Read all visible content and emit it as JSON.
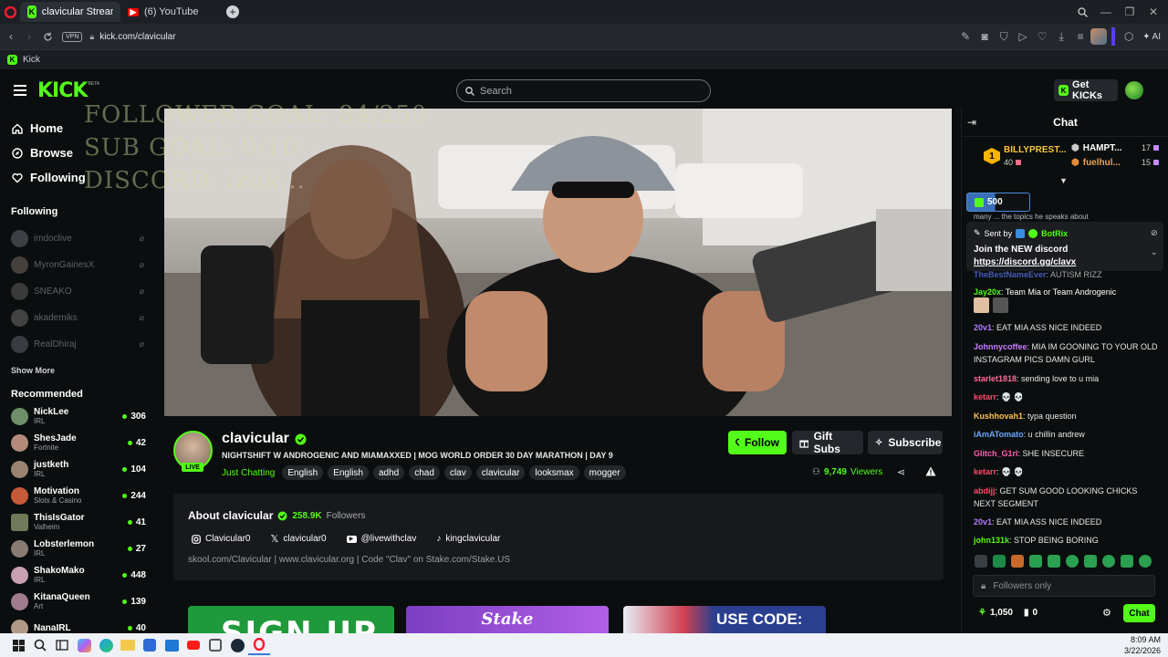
{
  "browser": {
    "tabs": [
      {
        "label": "clavicular Stream - W...",
        "active": true
      },
      {
        "label": "(6) YouTube",
        "active": false
      }
    ],
    "url": "kick.com/clavicular",
    "vpn": "VPN",
    "bookmark": "Kick",
    "ai_label": "AI"
  },
  "header": {
    "logo": "KICK",
    "logo_badge": "BETA",
    "search_placeholder": "Search",
    "get_kicks": "Get KICKs"
  },
  "sidebar": {
    "nav": [
      {
        "label": "Home",
        "icon": "home-icon"
      },
      {
        "label": "Browse",
        "icon": "compass-icon"
      },
      {
        "label": "Following",
        "icon": "heart-icon"
      }
    ],
    "following_title": "Following",
    "following": [
      "imdoclive",
      "MyronGainesX",
      "SNEAKO",
      "akademiks",
      "RealDhiraj"
    ],
    "show_more": "Show More",
    "recommended_title": "Recommended",
    "recommended": [
      {
        "name": "NickLee",
        "category": "IRL",
        "viewers": "306"
      },
      {
        "name": "ShesJade",
        "category": "Fortnite",
        "viewers": "42"
      },
      {
        "name": "justketh",
        "category": "IRL",
        "viewers": "104"
      },
      {
        "name": "Motivation",
        "category": "Slots & Casino",
        "viewers": "244"
      },
      {
        "name": "ThisIsGator",
        "category": "Valheim",
        "viewers": "41"
      },
      {
        "name": "Lobsterlemon",
        "category": "IRL",
        "viewers": "27"
      },
      {
        "name": "ShakoMako",
        "category": "IRL",
        "viewers": "448"
      },
      {
        "name": "KitanaQueen",
        "category": "Art",
        "viewers": "139"
      },
      {
        "name": "NanaIRL",
        "category": "",
        "viewers": "40"
      }
    ]
  },
  "video": {
    "overlay_lines": [
      "FOLLOWER GOAL: 84/250",
      "SUB GOAL: 0/10",
      "DISCORD: izuk..."
    ]
  },
  "stream": {
    "channel": "clavicular",
    "live_label": "LIVE",
    "title": "NIGHTSHIFT W ANDROGENIC AND MIAMAXXED | MOG WORLD ORDER 30 DAY MARATHON | DAY 9",
    "category": "Just Chatting",
    "tags": [
      "English",
      "English",
      "adhd",
      "chad",
      "clav",
      "clavicular",
      "looksmax",
      "mogger"
    ],
    "follow_label": "Follow",
    "gift_label": "Gift Subs",
    "subscribe_label": "Subscribe",
    "viewers": "9,749",
    "viewers_label": "Viewers"
  },
  "about": {
    "title": "About clavicular",
    "followers": "258.9K",
    "followers_label": "Followers",
    "socials": [
      {
        "icon": "instagram-icon",
        "label": "Clavicular0"
      },
      {
        "icon": "x-icon",
        "label": "clavicular0"
      },
      {
        "icon": "youtube-icon",
        "label": "@livewithclav"
      },
      {
        "icon": "tiktok-icon",
        "label": "kingclavicular"
      }
    ],
    "links": "skool.com/Clavicular | www.clavicular.org | Code \"Clav\" on Stake.com/Stake.US"
  },
  "panels": [
    {
      "label": "SIGN UP",
      "color": "#1f9a3a"
    },
    {
      "label": "Stake",
      "color": "#8e44c9"
    },
    {
      "label": "USE CODE:",
      "color": "#2a3f8f"
    }
  ],
  "chat": {
    "title": "Chat",
    "leaderboard": [
      {
        "rank": "1",
        "name": "BILLYPREST...",
        "value": "40"
      },
      {
        "name": "HAMPT...",
        "value": "17"
      },
      {
        "name": "fuelhul...",
        "value": "15"
      }
    ],
    "kicks_amount": "500",
    "pinned_sent_by": "Sent by",
    "pinned_sender": "BotRix",
    "pinned_text": "Join the NEW discord",
    "pinned_link": "https://discord.gg/clavx",
    "partial_line": "many ... the topics he speaks about",
    "messages": [
      {
        "user": "TheBestNameEver",
        "text": ": AUTISM RIZZ",
        "color": "#5b7cff"
      },
      {
        "user": "Jay20x",
        "text": ": Team Mia or Team Androgenic",
        "color": "#53fc18"
      },
      {
        "user": "20v1",
        "text": ": EAT MIA ASS NICE INDEED",
        "color": "#b57bff"
      },
      {
        "user": "Johnnycoffee",
        "text": ": MIA IM GOONING TO YOUR OLD INSTAGRAM PICS DAMN GURL",
        "color": "#c77dff"
      },
      {
        "user": "starlet1818",
        "text": ": sending love to u mia",
        "color": "#ff6b9e"
      },
      {
        "user": "ketarr",
        "text": ": 💀 💀",
        "color": "#ff4a6a"
      },
      {
        "user": "Kushhovah1",
        "text": ": typa question",
        "color": "#ffc14d"
      },
      {
        "user": "iAmATomato",
        "text": ": u chillin andrew",
        "color": "#6aa8ff"
      },
      {
        "user": "Glitch_G1rl",
        "text": ": SHE INSECURE",
        "color": "#ff5db1"
      },
      {
        "user": "ketarr",
        "text": ": 💀 💀",
        "color": "#ff4a6a"
      },
      {
        "user": "abdijj",
        "text": ": GET SUM GOOD LOOKING CHICKS NEXT SEGMENT",
        "color": "#ff4a6a"
      },
      {
        "user": "20v1",
        "text": ": EAT MIA ASS NICE INDEED",
        "color": "#b57bff"
      },
      {
        "user": "john131k",
        "text": ": STOP BEING BORING",
        "color": "#53fc18"
      }
    ],
    "input_placeholder": "Followers only",
    "kicks_balance": "1,050",
    "points": "0",
    "send_label": "Chat"
  },
  "taskbar": {
    "time": "8:09 AM",
    "date": "3/22/2026"
  },
  "colors": {
    "brand": "#53fc18",
    "background": "#0b0e0f"
  }
}
